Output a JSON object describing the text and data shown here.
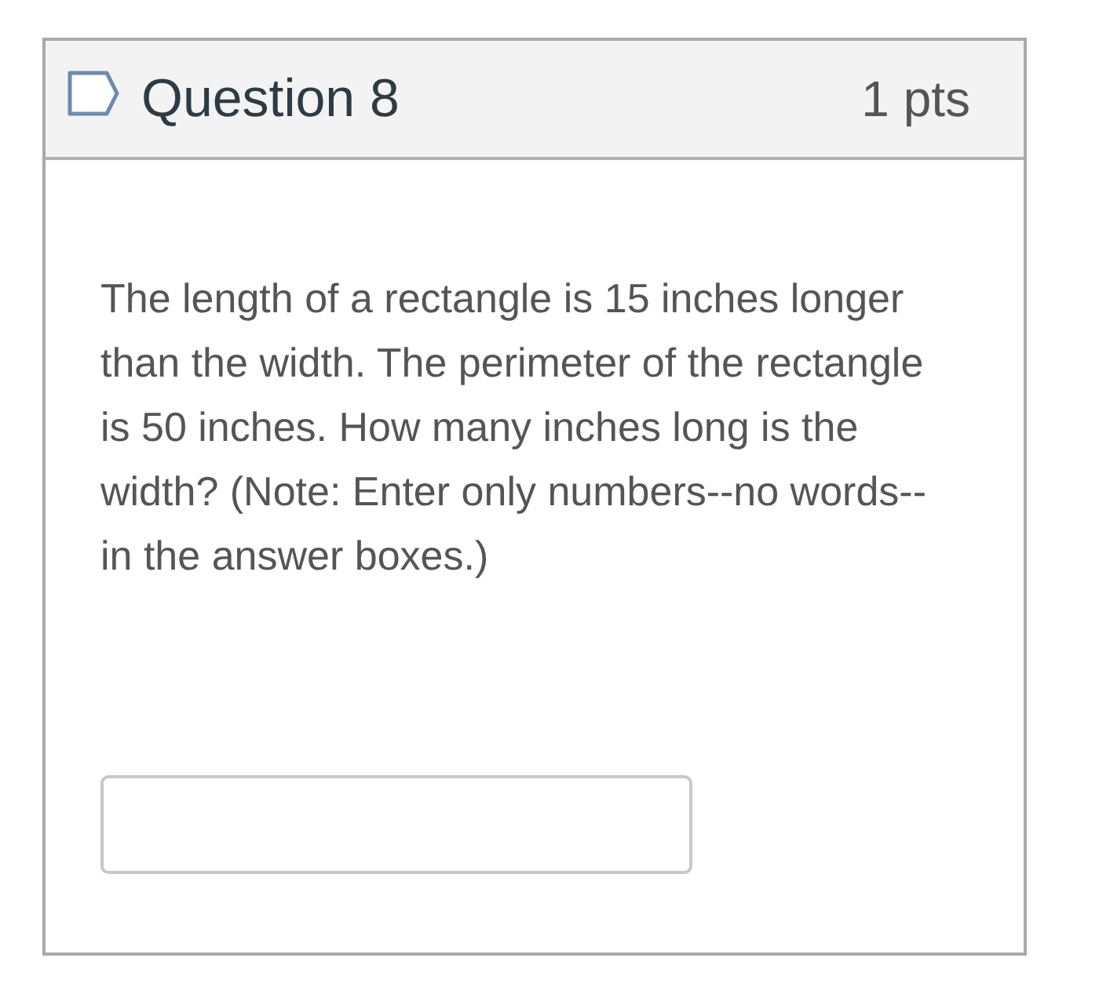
{
  "question": {
    "flagged": false,
    "title": "Question 8",
    "points": "1 pts"
  },
  "body": {
    "text": "The length of a rectangle is 15 inches longer than the width. The perimeter of the rectangle is 50 inches. How many inches long is the width? (Note: Enter only numbers--no words--in the answer boxes.)"
  }
}
